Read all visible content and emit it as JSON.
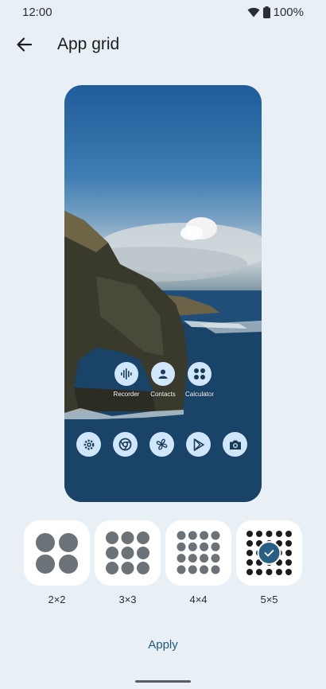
{
  "status_bar": {
    "time": "12:00",
    "battery": "100%"
  },
  "header": {
    "title": "App grid"
  },
  "preview": {
    "apps": [
      {
        "label": "Recorder",
        "icon": "recorder-icon"
      },
      {
        "label": "Contacts",
        "icon": "contacts-icon"
      },
      {
        "label": "Calculator",
        "icon": "calculator-icon"
      }
    ],
    "dock": [
      "settings-icon",
      "chrome-icon",
      "fan-icon",
      "play-store-icon",
      "camera-icon"
    ]
  },
  "grid_options": [
    {
      "label": "2×2",
      "selected": false
    },
    {
      "label": "3×3",
      "selected": false
    },
    {
      "label": "4×4",
      "selected": false
    },
    {
      "label": "5×5",
      "selected": true
    }
  ],
  "apply_label": "Apply",
  "colors": {
    "accent": "#1e5a80",
    "tile": "#ffffff",
    "dot": "#6c7378",
    "background": "#e8f0f6"
  }
}
